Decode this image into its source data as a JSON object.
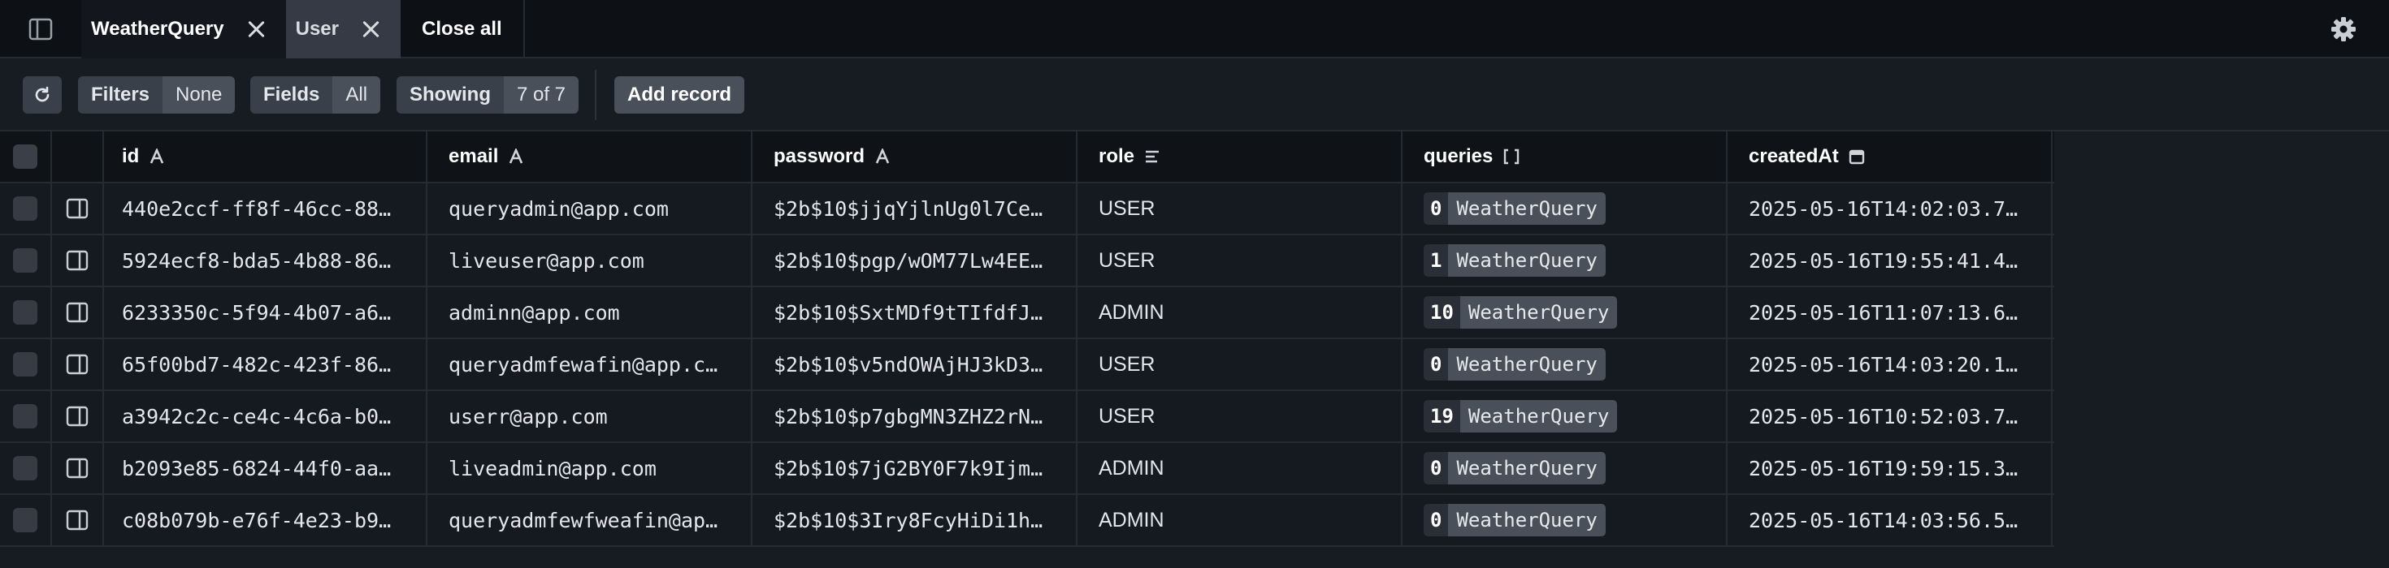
{
  "tabs": {
    "items": [
      {
        "label": "WeatherQuery"
      },
      {
        "label": "User"
      }
    ],
    "close_all": "Close all"
  },
  "toolbar": {
    "filters_label": "Filters",
    "filters_value": "None",
    "fields_label": "Fields",
    "fields_value": "All",
    "showing_label": "Showing",
    "showing_value": "7 of 7",
    "add_record": "Add record"
  },
  "columns": [
    {
      "label": "id",
      "icon": "text-type-icon"
    },
    {
      "label": "email",
      "icon": "text-type-icon"
    },
    {
      "label": "password",
      "icon": "text-type-icon"
    },
    {
      "label": "role",
      "icon": "enum-type-icon"
    },
    {
      "label": "queries",
      "icon": "list-type-icon"
    },
    {
      "label": "createdAt",
      "icon": "date-type-icon"
    }
  ],
  "rows": [
    {
      "id": "440e2ccf-ff8f-46cc-88…",
      "email": "queryadmin@app.com",
      "password": "$2b$10$jjqYjlnUg0l7Ce…",
      "role": "USER",
      "queries_count": "0",
      "queries_rel": "WeatherQuery",
      "createdAt": "2025-05-16T14:02:03.7…"
    },
    {
      "id": "5924ecf8-bda5-4b88-86…",
      "email": "liveuser@app.com",
      "password": "$2b$10$pgp/wOM77Lw4EE…",
      "role": "USER",
      "queries_count": "1",
      "queries_rel": "WeatherQuery",
      "createdAt": "2025-05-16T19:55:41.4…"
    },
    {
      "id": "6233350c-5f94-4b07-a6…",
      "email": "adminn@app.com",
      "password": "$2b$10$SxtMDf9tTIfdfJ…",
      "role": "ADMIN",
      "queries_count": "10",
      "queries_rel": "WeatherQuery",
      "createdAt": "2025-05-16T11:07:13.6…"
    },
    {
      "id": "65f00bd7-482c-423f-86…",
      "email": "queryadmfewafin@app.c…",
      "password": "$2b$10$v5ndOWAjHJ3kD3…",
      "role": "USER",
      "queries_count": "0",
      "queries_rel": "WeatherQuery",
      "createdAt": "2025-05-16T14:03:20.1…"
    },
    {
      "id": "a3942c2c-ce4c-4c6a-b0…",
      "email": "userr@app.com",
      "password": "$2b$10$p7gbgMN3ZHZ2rN…",
      "role": "USER",
      "queries_count": "19",
      "queries_rel": "WeatherQuery",
      "createdAt": "2025-05-16T10:52:03.7…"
    },
    {
      "id": "b2093e85-6824-44f0-aa…",
      "email": "liveadmin@app.com",
      "password": "$2b$10$7jG2BY0F7k9Ijm…",
      "role": "ADMIN",
      "queries_count": "0",
      "queries_rel": "WeatherQuery",
      "createdAt": "2025-05-16T19:59:15.3…"
    },
    {
      "id": "c08b079b-e76f-4e23-b9…",
      "email": "queryadmfewfweafin@ap…",
      "password": "$2b$10$3Iry8FcyHiDi1h…",
      "role": "ADMIN",
      "queries_count": "0",
      "queries_rel": "WeatherQuery",
      "createdAt": "2025-05-16T14:03:56.5…"
    }
  ]
}
